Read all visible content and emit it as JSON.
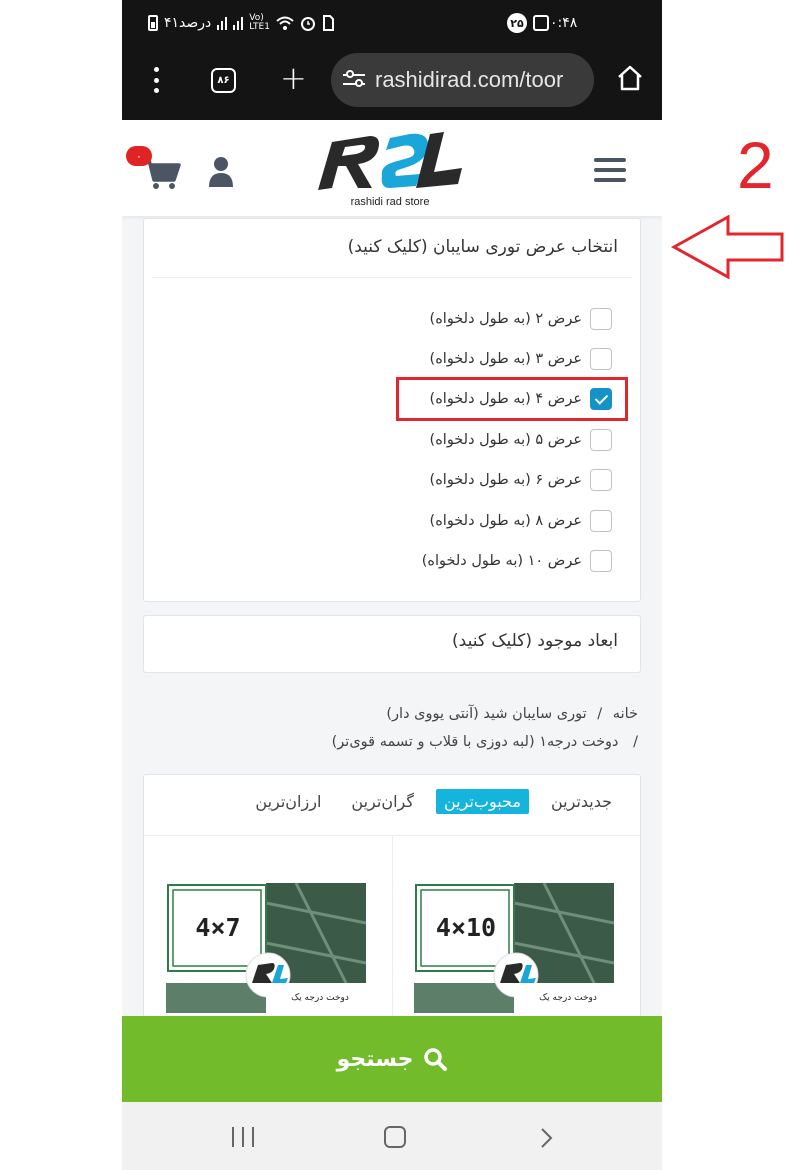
{
  "status_bar": {
    "time": "۰:۴۸",
    "notification_count": "۲۵",
    "battery_text": "۴۱درصد",
    "network_label_top": "Vo)",
    "network_label_bottom": "LTE1"
  },
  "browser": {
    "url": "rashidirad.com/toor",
    "tab_count": "۸۶",
    "menu_icon": "kebab-menu-icon",
    "new_tab_icon": "plus-icon",
    "home_icon": "home-icon"
  },
  "site_header": {
    "logo_subtitle": "rashidi rad store",
    "cart_count": "۰",
    "menu_icon": "hamburger-icon"
  },
  "width_filter": {
    "title": "انتخاب عرض توری سایبان (کلیک کنید)",
    "options": [
      {
        "label": "عرض ۲ (به طول دلخواه)",
        "checked": false
      },
      {
        "label": "عرض ۳ (به طول دلخواه)",
        "checked": false
      },
      {
        "label": "عرض ۴ (به طول دلخواه)",
        "checked": true
      },
      {
        "label": "عرض ۵ (به طول دلخواه)",
        "checked": false
      },
      {
        "label": "عرض ۶ (به طول دلخواه)",
        "checked": false
      },
      {
        "label": "عرض ۸ (به طول دلخواه)",
        "checked": false
      },
      {
        "label": "عرض ۱۰ (به طول دلخواه)",
        "checked": false
      }
    ]
  },
  "dimensions_filter": {
    "title": "ابعاد موجود (کلیک کنید)"
  },
  "breadcrumb": {
    "home": "خانه",
    "sep": "/",
    "category": "توری سایبان شید (آنتی یووی دار)",
    "sub": "دوخت درجه۱ (لبه دوزی با قلاب و تسمه قوی‌تر)"
  },
  "sort_tabs": [
    {
      "label": "جدیدترین",
      "active": false
    },
    {
      "label": "محبوب‌ترین",
      "active": true
    },
    {
      "label": "گران‌ترین",
      "active": false
    },
    {
      "label": "ارزان‌ترین",
      "active": false
    }
  ],
  "products": [
    {
      "size_label": "4×10",
      "caption": "دوخت درجه یک"
    },
    {
      "size_label": "4×7",
      "caption": "دوخت درجه یک"
    }
  ],
  "search_bar": {
    "label": "جستجو",
    "icon": "search-icon"
  },
  "annotation": {
    "step_number": "2"
  },
  "colors": {
    "accent_blue": "#15b4dc",
    "checkbox_blue": "#1493c7",
    "search_green": "#72bc2b",
    "annotation_red": "#e3262e",
    "badge_red": "#e02424"
  }
}
